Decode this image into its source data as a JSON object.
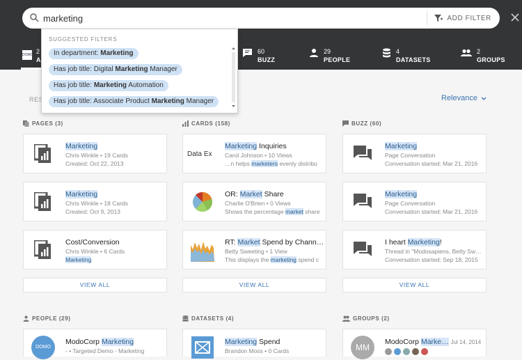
{
  "search": {
    "value": "marketing",
    "add_filter_label": "ADD FILTER"
  },
  "tabs": {
    "all": {
      "count": "2",
      "label": "A"
    },
    "items": [
      {
        "count": "60",
        "label": "BUZZ"
      },
      {
        "count": "29",
        "label": "PEOPLE"
      },
      {
        "count": "4",
        "label": "DATASETS"
      },
      {
        "count": "2",
        "label": "GROUPS"
      }
    ]
  },
  "logo_text": "DOMO",
  "dropdown": {
    "title": "SUGGESTED FILTERS",
    "items": [
      {
        "prefix": "In department: ",
        "bold": "Marketing",
        "suffix": ""
      },
      {
        "prefix": "Has job title: Digital ",
        "bold": "Marketing",
        "suffix": " Manager"
      },
      {
        "prefix": "Has job title: ",
        "bold": "Marketing",
        "suffix": " Automation"
      },
      {
        "prefix": "Has job title: Associate Product ",
        "bold": "Marketing",
        "suffix": " Manager"
      }
    ]
  },
  "results_label": "RES",
  "sort": {
    "label": "Relevance"
  },
  "sections": {
    "pages": "PAGES (3)",
    "cards": "CARDS (158)",
    "buzz": "BUZZ (60)",
    "people": "PEOPLE (29)",
    "datasets": "DATASETS (4)",
    "groups": "GROUPS (2)"
  },
  "view_all": "VIEW ALL",
  "pages": [
    {
      "title_hl": "Marketing",
      "title_rest": "",
      "l2": "Chris Winkle • 19 Cards",
      "l3": "Created: Oct 22, 2013"
    },
    {
      "title_hl": "Marketing",
      "title_rest": "",
      "l2": "Chris Winkle • 18 Cards",
      "l3": "Created: Oct 9, 2013"
    },
    {
      "title_pre": "Cost/Conversion",
      "l2": "Chris Winkle • 6 Cards",
      "l3_hl": "Marketing"
    }
  ],
  "cards": [
    {
      "thumb_text": "Data Ex",
      "title_hl": "Marketing",
      "title_rest": " Inquiries",
      "l2": "Carol Johnson • 10 Views",
      "l3_pre": "…n helps ",
      "l3_hl": "marketers",
      "l3_post": " evenly distribu"
    },
    {
      "title_pre": "OR: ",
      "title_hl": "Market",
      "title_rest": " Share",
      "l2": "Charlie O'Brien • 0 Views",
      "l3_pre": "Shows the percentage ",
      "l3_hl": "market",
      "l3_post": " share"
    },
    {
      "title_pre": "RT: ",
      "title_hl": "Market",
      "title_rest": " Spend by Chann…",
      "l2": "Betty Sweeting • 1 View",
      "l3_pre": "This displays the ",
      "l3_hl": "marketing",
      "l3_post": " spend c"
    }
  ],
  "buzz": [
    {
      "title_hl": "Marketing",
      "title_rest": "",
      "l2": "Page Conversation",
      "l3": "Conversation started: Mar 21, 2016"
    },
    {
      "title_hl": "Marketing",
      "title_rest": "",
      "l2": "Page Conversation",
      "l3": "Conversation started: Mar 21, 2016"
    },
    {
      "title_pre": "I heart ",
      "title_hl": "Marketing",
      "title_rest": "!",
      "l2": "Thread in \"Modosapiens, Betty Sw…",
      "l3": "Conversation started: Sep 18, 2015"
    }
  ],
  "people": [
    {
      "title_pre": "ModoCorp ",
      "title_hl": "Marketing",
      "l2": "- • Targeted Demo - Marketing",
      "avatar_text": "DOMO"
    }
  ],
  "datasets": [
    {
      "title_hl": "Marketing",
      "title_rest": " Spend",
      "l2": "Brandon Moss • 0 Cards"
    }
  ],
  "groups": [
    {
      "title_pre": "ModoCorp ",
      "title_hl": "Marke…",
      "date": "Jul 14, 2014",
      "avatar_text": "MM"
    }
  ],
  "colors": {
    "topbar": "#333537",
    "accent": "#3c74b0",
    "highlight": "#d6e6f7"
  }
}
